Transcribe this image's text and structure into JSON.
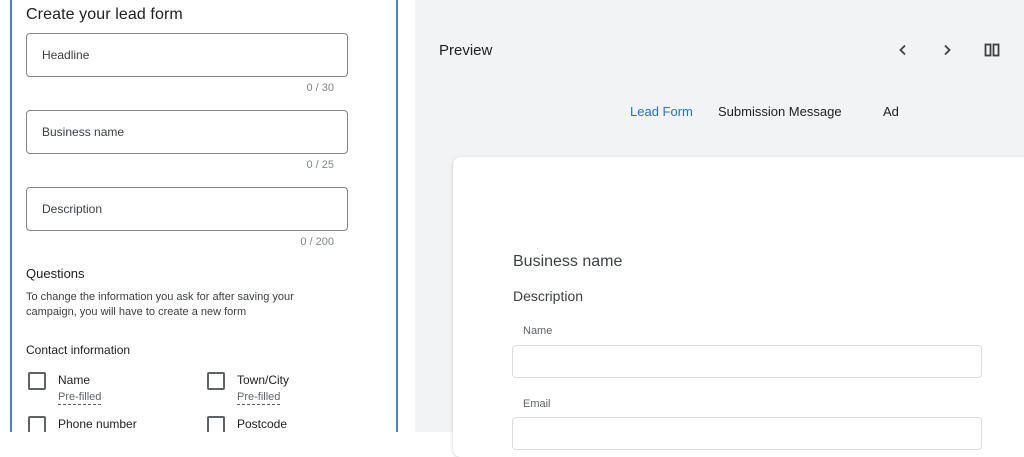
{
  "editor": {
    "title": "Create your lead form",
    "fields": {
      "headline": {
        "placeholder": "Headline",
        "counter": "0 / 30"
      },
      "business_name": {
        "placeholder": "Business name",
        "counter": "0 / 25"
      },
      "description": {
        "placeholder": "Description",
        "counter": "0 / 200"
      }
    },
    "questions": {
      "title": "Questions",
      "help": "To change the information you ask for after saving your campaign, you will have to create a new form",
      "contact_info_title": "Contact information",
      "items": [
        {
          "label": "Name",
          "sub": "Pre-filled"
        },
        {
          "label": "Town/City",
          "sub": "Pre-filled"
        },
        {
          "label": "Phone number",
          "sub": ""
        },
        {
          "label": "Postcode",
          "sub": ""
        }
      ]
    }
  },
  "preview": {
    "title": "Preview",
    "tabs": [
      "Lead Form",
      "Submission Message",
      "Ad"
    ],
    "active_tab": "Lead Form",
    "card": {
      "business_name": "Business name",
      "description": "Description",
      "field_labels": [
        "Name",
        "Email"
      ]
    }
  },
  "colors": {
    "accent": "#1a73e8",
    "panel_border": "#4a7fd1",
    "preview_bg": "#f1f3f4"
  },
  "icons": [
    "chevron-left-icon",
    "chevron-right-icon",
    "split-view-icon"
  ]
}
